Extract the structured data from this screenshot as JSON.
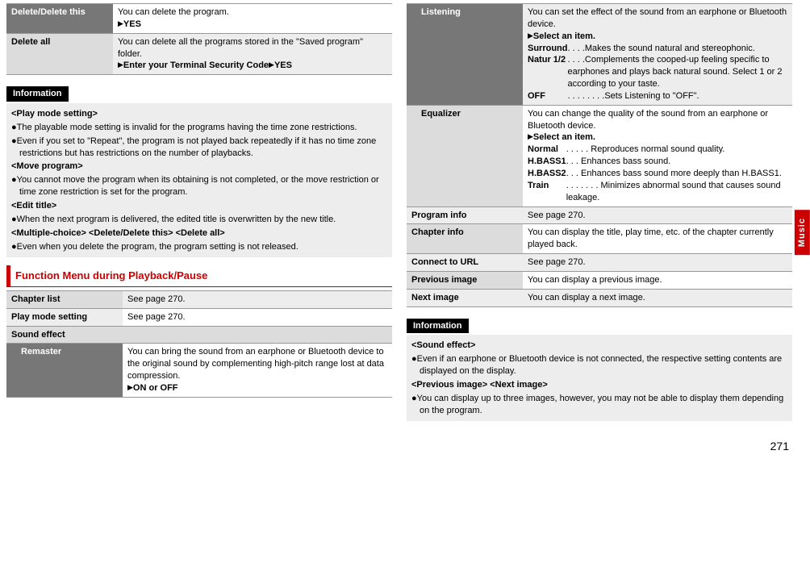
{
  "left": {
    "table1": {
      "r1": {
        "label": "Delete/Delete this",
        "text": "You can delete the program.",
        "cmd": "YES"
      },
      "r2": {
        "label": "Delete all",
        "text": "You can delete all the programs stored in the \"Saved program\" folder.",
        "cmd1": "Enter your Terminal Security Code",
        "cmd2": "YES"
      }
    },
    "info": {
      "tag": "Information",
      "play_title": "<Play mode setting>",
      "play_b1": "The playable mode setting is invalid for the programs having the time zone restrictions.",
      "play_b2": "Even if you set to \"Repeat\", the program is not played back repeatedly if it has no time zone restrictions but has restrictions on the number of playbacks.",
      "move_title": "<Move program>",
      "move_b1": "You cannot move the program when its obtaining is not completed, or the move restriction or time zone restriction is set for the program.",
      "edit_title": "<Edit title>",
      "edit_b1": "When the next program is delivered, the edited title is overwritten by the new title.",
      "del_title": "<Multiple-choice> <Delete/Delete this> <Delete all>",
      "del_b1": "Even when you delete the program, the program setting is not released."
    },
    "section": "Function Menu during Playback/Pause",
    "table2": {
      "r1": {
        "label": "Chapter list",
        "text": "See page 270."
      },
      "r2": {
        "label": "Play mode setting",
        "text": "See page 270."
      },
      "r3": {
        "label": "Sound effect"
      },
      "r4": {
        "label": "Remaster",
        "text": "You can bring the sound from an earphone or Bluetooth device to the original sound by complementing high-pitch range lost at data compression.",
        "cmd": "ON or OFF"
      }
    }
  },
  "right": {
    "table1": {
      "listening": {
        "label": "Listening",
        "intro": "You can set the effect of the sound from an earphone or Bluetooth device.",
        "cmd": "Select an item.",
        "surround_t": "Surround",
        "surround_d": ". . . .Makes the sound natural and stereophonic.",
        "natur_t": "Natur 1/2",
        "natur_d1": " . . . .Complements the cooped-up feeling specific to earphones and plays back natural sound. Select 1 or 2 according to your taste.",
        "off_t": "OFF",
        "off_d": " . . . . . . . .Sets Listening to \"OFF\"."
      },
      "equalizer": {
        "label": "Equalizer",
        "intro": "You can change the quality of the sound from an earphone or Bluetooth device.",
        "cmd": "Select an item.",
        "normal_t": "Normal",
        "normal_d": ". . . . . Reproduces normal sound quality.",
        "hb1_t": "H.BASS1",
        "hb1_d": " . . . Enhances bass sound.",
        "hb2_t": "H.BASS2",
        "hb2_d": " . . . Enhances bass sound more deeply than H.BASS1.",
        "train_t": "Train",
        "train_d": ". . . . . . . Minimizes abnormal sound that causes sound leakage."
      },
      "r3": {
        "label": "Program info",
        "text": "See page 270."
      },
      "r4": {
        "label": "Chapter info",
        "text": "You can display the title, play time, etc. of the chapter currently played back."
      },
      "r5": {
        "label": "Connect to URL",
        "text": "See page 270."
      },
      "r6": {
        "label": "Previous image",
        "text": "You can display a previous image."
      },
      "r7": {
        "label": "Next image",
        "text": "You can display a next image."
      }
    },
    "info": {
      "tag": "Information",
      "se_title": "<Sound effect>",
      "se_b1": "Even if an earphone or Bluetooth device is not connected, the respective setting contents are displayed on the display.",
      "pi_title": "<Previous image> <Next image>",
      "pi_b1": "You can display up to three images, however, you may not be able to display them depending on the program."
    }
  },
  "side_tab": "Music",
  "page_number": "271"
}
